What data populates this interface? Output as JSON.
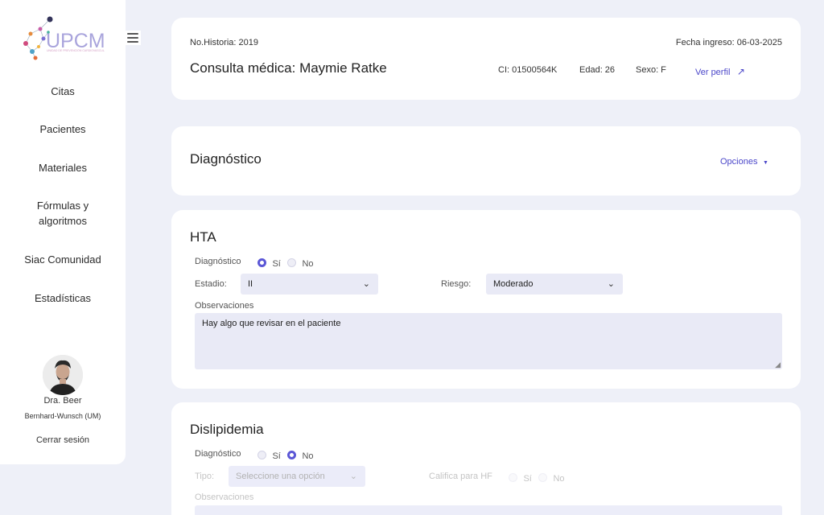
{
  "sidebar": {
    "logo_text": "UPCM",
    "logo_subtitle": "UNIDAD DE PREVENCIÓN CARDIOVASCULAR",
    "menu_items": [
      {
        "label": "Citas"
      },
      {
        "label": "Pacientes"
      },
      {
        "label": "Materiales"
      },
      {
        "label": "Fórmulas y algoritmos"
      },
      {
        "label": "Siac Comunidad"
      },
      {
        "label": "Estadísticas"
      }
    ],
    "user": {
      "name": "Dra. Beer",
      "org": "Bernhard-Wunsch (UM)"
    },
    "logout_label": "Cerrar sesión"
  },
  "header": {
    "historia": "No.Historia: 2019",
    "fecha_ingreso": "Fecha ingreso: 06-03-2025",
    "title": "Consulta médica: Maymie Ratke",
    "ci": "CI: 01500564K",
    "edad": "Edad: 26",
    "sexo": "Sexo: F",
    "ver_perfil": "Ver perfil"
  },
  "diagnostico": {
    "title": "Diagnóstico",
    "opciones": "Opciones"
  },
  "hta": {
    "title": "HTA",
    "diag_label": "Diagnóstico",
    "yes_label": "Sí",
    "no_label": "No",
    "selected": "yes",
    "estadio_label": "Estadio:",
    "estadio_value": "II",
    "riesgo_label": "Riesgo:",
    "riesgo_value": "Moderado",
    "obs_label": "Observaciones",
    "obs_value": "Hay algo que revisar en el paciente"
  },
  "dislipidemia": {
    "title": "Dislipidemia",
    "diag_label": "Diagnóstico",
    "yes_label": "Sí",
    "no_label": "No",
    "selected": "no",
    "tipo_label": "Tipo:",
    "tipo_placeholder": "Seleccione una opción",
    "califica_label": "Califica para HF",
    "califica_yes": "Sí",
    "califica_no": "No",
    "obs_label": "Observaciones"
  },
  "colors": {
    "accent": "#5b57d6",
    "background": "#eef0f8",
    "input_bg": "#e9eaf6"
  }
}
